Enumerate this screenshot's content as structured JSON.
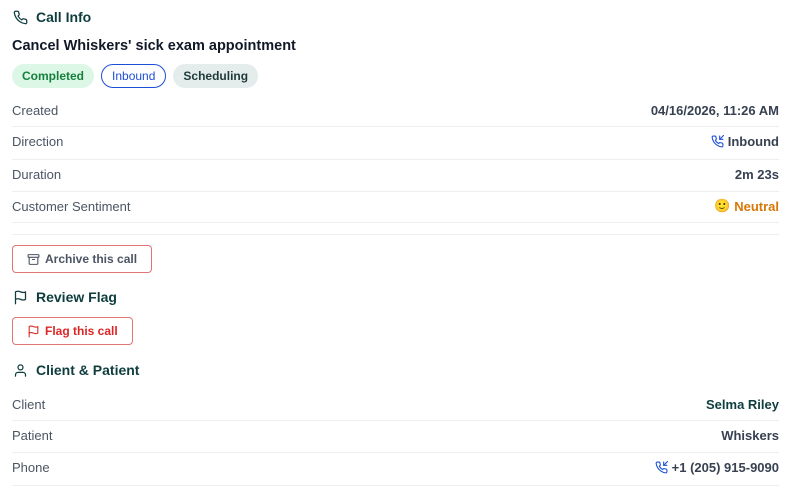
{
  "call_info": {
    "header": "Call Info",
    "title": "Cancel Whiskers' sick exam appointment",
    "badges": {
      "status": "Completed",
      "direction": "Inbound",
      "category": "Scheduling"
    },
    "rows": {
      "created": {
        "label": "Created",
        "value": "04/16/2026, 11:26 AM"
      },
      "direction": {
        "label": "Direction",
        "value": "Inbound"
      },
      "duration": {
        "label": "Duration",
        "value": "2m 23s"
      },
      "sentiment": {
        "label": "Customer Sentiment",
        "value": "Neutral",
        "emoji": "🙂"
      }
    },
    "archive_label": "Archive this call"
  },
  "review_flag": {
    "header": "Review Flag",
    "button_label": "Flag this call"
  },
  "client_patient": {
    "header": "Client & Patient",
    "rows": {
      "client": {
        "label": "Client",
        "value": "Selma Riley"
      },
      "patient": {
        "label": "Patient",
        "value": "Whiskers"
      },
      "phone": {
        "label": "Phone",
        "value": "+1 (205) 915-9090"
      }
    }
  },
  "icons": {
    "call_info": "phone-icon",
    "direction": "phone-incoming-icon",
    "archive": "archive-icon",
    "review_flag": "flag-icon",
    "client_patient": "user-icon"
  },
  "colors": {
    "header_teal": "#0f3d3e",
    "completed_bg": "#dcf7e6",
    "completed_text": "#15803d",
    "inbound_blue": "#1d4ed8",
    "flag_red": "#dc2626",
    "neutral_orange": "#d97706"
  }
}
